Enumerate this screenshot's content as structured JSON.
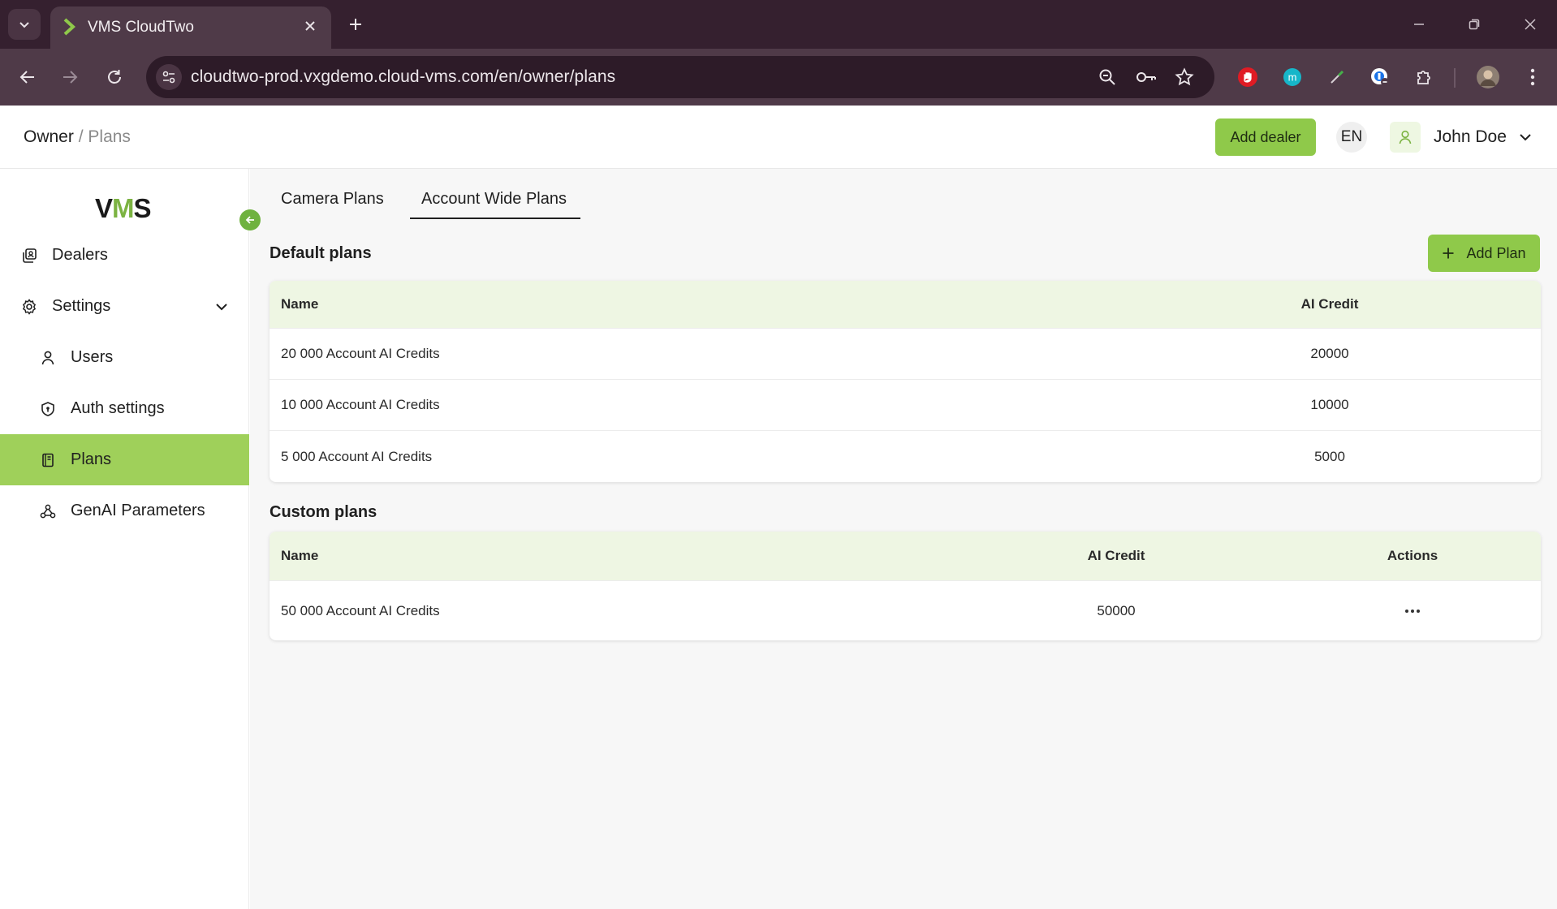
{
  "browser": {
    "tab_title": "VMS CloudTwo",
    "url": "cloudtwo-prod.vxgdemo.cloud-vms.com/en/owner/plans",
    "extensions": [
      "ublock-icon",
      "m-extension-icon",
      "eyedropper-icon",
      "password-manager-icon",
      "extensions-puzzle-icon",
      "profile-avatar-icon"
    ]
  },
  "header": {
    "breadcrumb_owner": "Owner",
    "breadcrumb_sep": "/",
    "breadcrumb_current": "Plans",
    "add_dealer_label": "Add dealer",
    "lang": "EN",
    "user_name": "John Doe"
  },
  "sidebar": {
    "logo_v": "V",
    "logo_m": "M",
    "logo_s": "S",
    "items": [
      {
        "label": "Dealers"
      },
      {
        "label": "Settings"
      },
      {
        "label": "Users"
      },
      {
        "label": "Auth settings"
      },
      {
        "label": "Plans"
      },
      {
        "label": "GenAI Parameters"
      }
    ]
  },
  "main": {
    "tabs": [
      {
        "label": "Camera Plans"
      },
      {
        "label": "Account Wide Plans"
      }
    ],
    "default_plans": {
      "title": "Default plans",
      "add_label": "Add Plan",
      "columns": [
        "Name",
        "AI Credit"
      ],
      "rows": [
        {
          "name": "20 000 Account AI Credits",
          "credit": "20000"
        },
        {
          "name": "10 000 Account AI Credits",
          "credit": "10000"
        },
        {
          "name": "5 000 Account AI Credits",
          "credit": "5000"
        }
      ]
    },
    "custom_plans": {
      "title": "Custom plans",
      "columns": [
        "Name",
        "AI Credit",
        "Actions"
      ],
      "rows": [
        {
          "name": "50 000 Account AI Credits",
          "credit": "50000"
        }
      ]
    }
  },
  "colors": {
    "accent_green": "#8fc94a",
    "active_nav": "#9fd05a",
    "table_header_bg": "#eef6e3",
    "browser_frame": "#35202f"
  }
}
